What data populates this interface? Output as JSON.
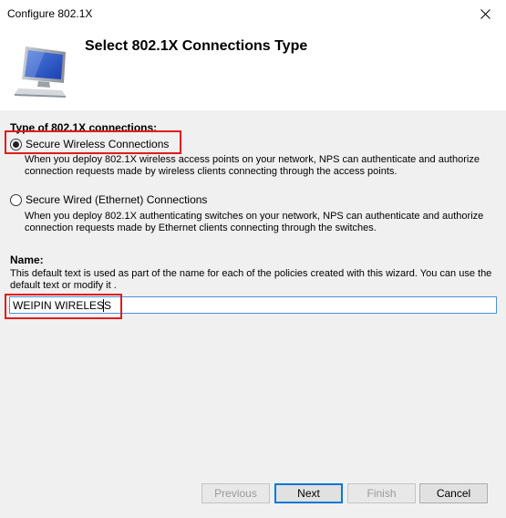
{
  "window": {
    "title": "Configure 802.1X"
  },
  "header": {
    "heading": "Select 802.1X Connections Type",
    "icon": "monitor-icon"
  },
  "connection_type": {
    "group_label": "Type of 802.1X connections:",
    "options": [
      {
        "label": "Secure Wireless Connections",
        "selected": true,
        "description": "When you deploy 802.1X wireless access points on your network, NPS can authenticate and authorize connection requests made by wireless clients connecting through the access points."
      },
      {
        "label": "Secure Wired (Ethernet) Connections",
        "selected": false,
        "description": "When you deploy 802.1X authenticating switches on your network, NPS can authenticate and authorize connection requests made by Ethernet clients connecting through the switches."
      }
    ]
  },
  "name": {
    "label": "Name:",
    "help": "This default text is used as part of the name for each of the policies created with this wizard. You can use the default text or modify it .",
    "value": "WEIPIN WIRELESS"
  },
  "footer": {
    "previous_label": "Previous",
    "next_label": "Next",
    "finish_label": "Finish",
    "cancel_label": "Cancel"
  },
  "colors": {
    "highlight": "#e21b1b",
    "input_border": "#4a90d9",
    "default_button_border": "#0078d7"
  }
}
